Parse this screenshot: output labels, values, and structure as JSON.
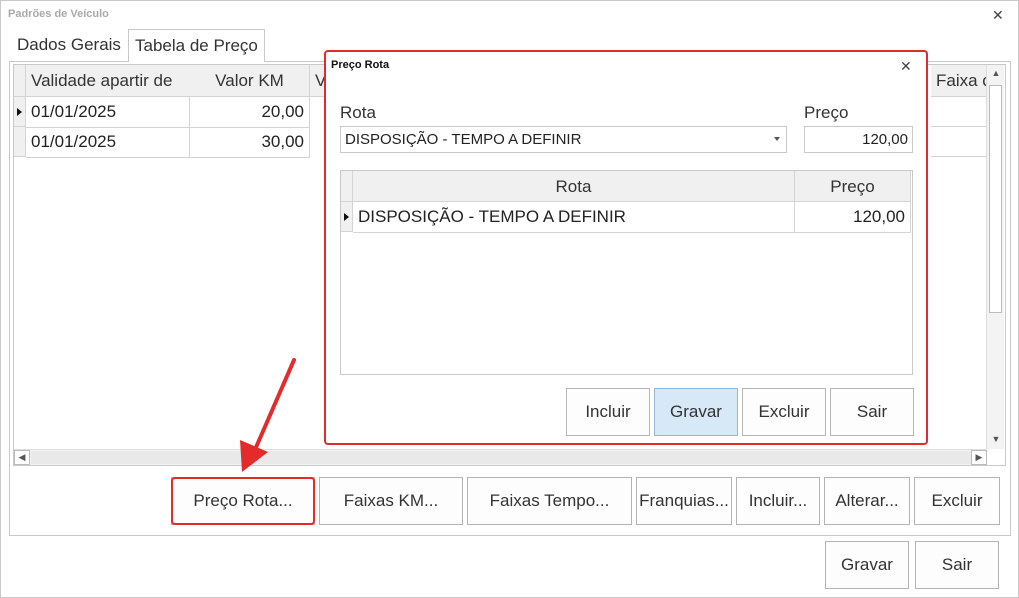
{
  "window": {
    "title": "Padrões de Veículo"
  },
  "tabs": [
    {
      "label": "Dados Gerais",
      "active": false
    },
    {
      "label": "Tabela de Preço",
      "active": true
    }
  ],
  "main_grid": {
    "columns": [
      "Validade apartir de",
      "Valor KM",
      "V",
      "Faixa c"
    ],
    "rows": [
      {
        "validade": "01/01/2025",
        "valor_km": "20,00"
      },
      {
        "validade": "01/01/2025",
        "valor_km": "30,00"
      }
    ]
  },
  "panel_buttons": {
    "preco_rota": "Preço Rota...",
    "faixas_km": "Faixas KM...",
    "faixas_tempo": "Faixas Tempo...",
    "franquias": "Franquias...",
    "incluir": "Incluir...",
    "alterar": "Alterar...",
    "excluir": "Excluir"
  },
  "footer_buttons": {
    "gravar": "Gravar",
    "sair": "Sair"
  },
  "dialog": {
    "title": "Preço Rota",
    "rota_label": "Rota",
    "rota_value": "DISPOSIÇÃO - TEMPO A DEFINIR",
    "preco_label": "Preço",
    "preco_value": "120,00",
    "grid": {
      "columns": [
        "Rota",
        "Preço"
      ],
      "rows": [
        {
          "rota": "DISPOSIÇÃO - TEMPO A DEFINIR",
          "preco": "120,00"
        }
      ]
    },
    "buttons": {
      "incluir": "Incluir",
      "gravar": "Gravar",
      "excluir": "Excluir",
      "sair": "Sair"
    }
  },
  "colors": {
    "highlight": "#e32b2b",
    "primary_button": "#d7e8f7"
  },
  "icons": {
    "close": "close-icon",
    "row_indicator": "row-indicator-icon",
    "dropdown": "chevron-down-icon",
    "annotation": "red-arrow-icon"
  }
}
